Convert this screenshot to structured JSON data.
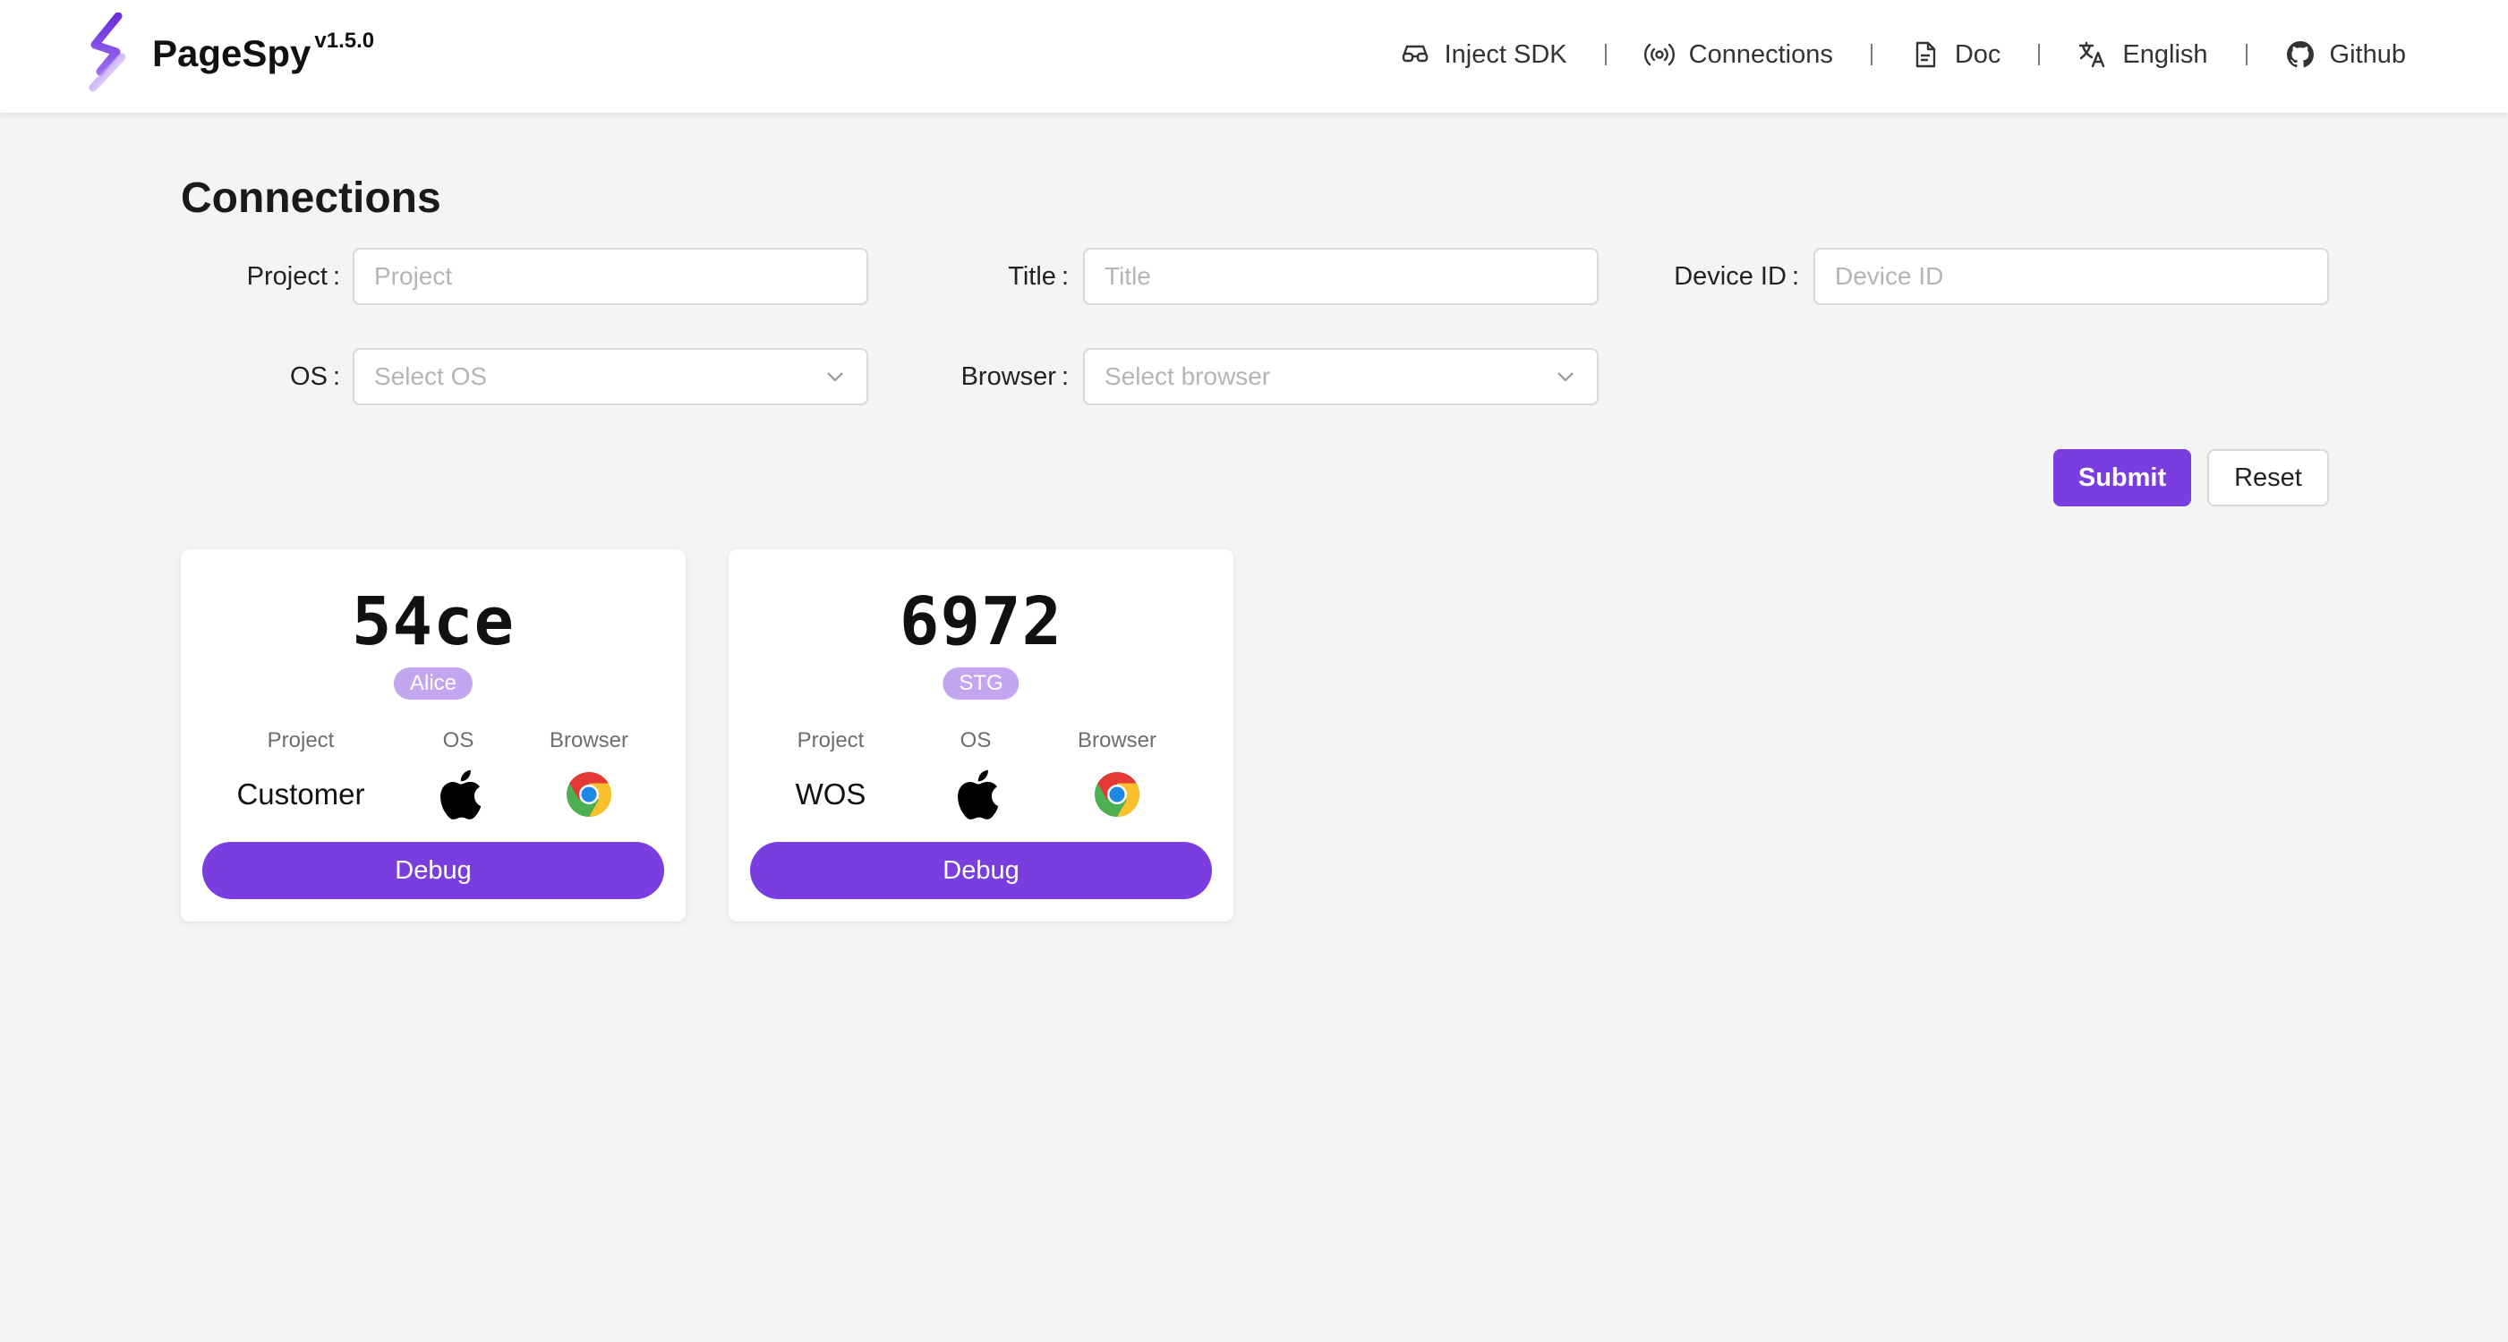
{
  "brand": {
    "name": "PageSpy",
    "version": "v1.5.0"
  },
  "nav": [
    {
      "label": "Inject SDK",
      "icon": "glasses-icon"
    },
    {
      "label": "Connections",
      "icon": "broadcast-icon"
    },
    {
      "label": "Doc",
      "icon": "document-icon"
    },
    {
      "label": "English",
      "icon": "translate-icon"
    },
    {
      "label": "Github",
      "icon": "github-icon"
    }
  ],
  "page": {
    "title": "Connections"
  },
  "filters": {
    "project": {
      "label": "Project",
      "placeholder": "Project"
    },
    "title": {
      "label": "Title",
      "placeholder": "Title"
    },
    "device_id": {
      "label": "Device ID",
      "placeholder": "Device ID"
    },
    "os": {
      "label": "OS",
      "placeholder": "Select OS"
    },
    "browser": {
      "label": "Browser",
      "placeholder": "Select browser"
    },
    "submit_label": "Submit",
    "reset_label": "Reset",
    "colon": ":"
  },
  "cards": [
    {
      "id": "54ce",
      "tag": "Alice",
      "project_label": "Project",
      "os_label": "OS",
      "browser_label": "Browser",
      "project": "Customer",
      "os": "apple-icon",
      "browser": "chrome-icon",
      "debug_label": "Debug"
    },
    {
      "id": "6972",
      "tag": "STG",
      "project_label": "Project",
      "os_label": "OS",
      "browser_label": "Browser",
      "project": "WOS",
      "os": "apple-icon",
      "browser": "chrome-icon",
      "debug_label": "Debug"
    }
  ],
  "colors": {
    "accent": "#7a3ee0",
    "tag": "#c4a6f0",
    "background": "#f4f4f4"
  }
}
